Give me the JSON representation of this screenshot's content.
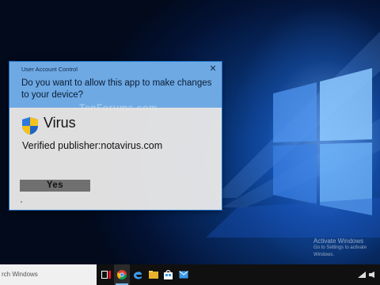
{
  "dialog": {
    "title": "User Account Control",
    "close_glyph": "✕",
    "question": "Do you want to allow this app to make changes to your device?",
    "watermark_text": "TenForums.com",
    "app_name": "Virus",
    "publisher": "Verified publisher:notavirus.com",
    "yes_label": "Yes"
  },
  "desktop": {
    "activate_title": "Activate Windows",
    "activate_sub": "Go to Settings to activate Windows."
  },
  "taskbar": {
    "search_placeholder": "rch Windows",
    "icons": [
      "task-view-icon",
      "chrome-icon",
      "edge-icon",
      "file-explorer-icon",
      "store-icon",
      "mail-icon"
    ],
    "tray": [
      "network-icon",
      "volume-icon"
    ]
  },
  "colors": {
    "dialog_header": "#6ea9e4",
    "dialog_body": "#e8e8e8",
    "yes_button": "#707070",
    "taskbar": "#101010",
    "accent": "#76b9ed"
  }
}
